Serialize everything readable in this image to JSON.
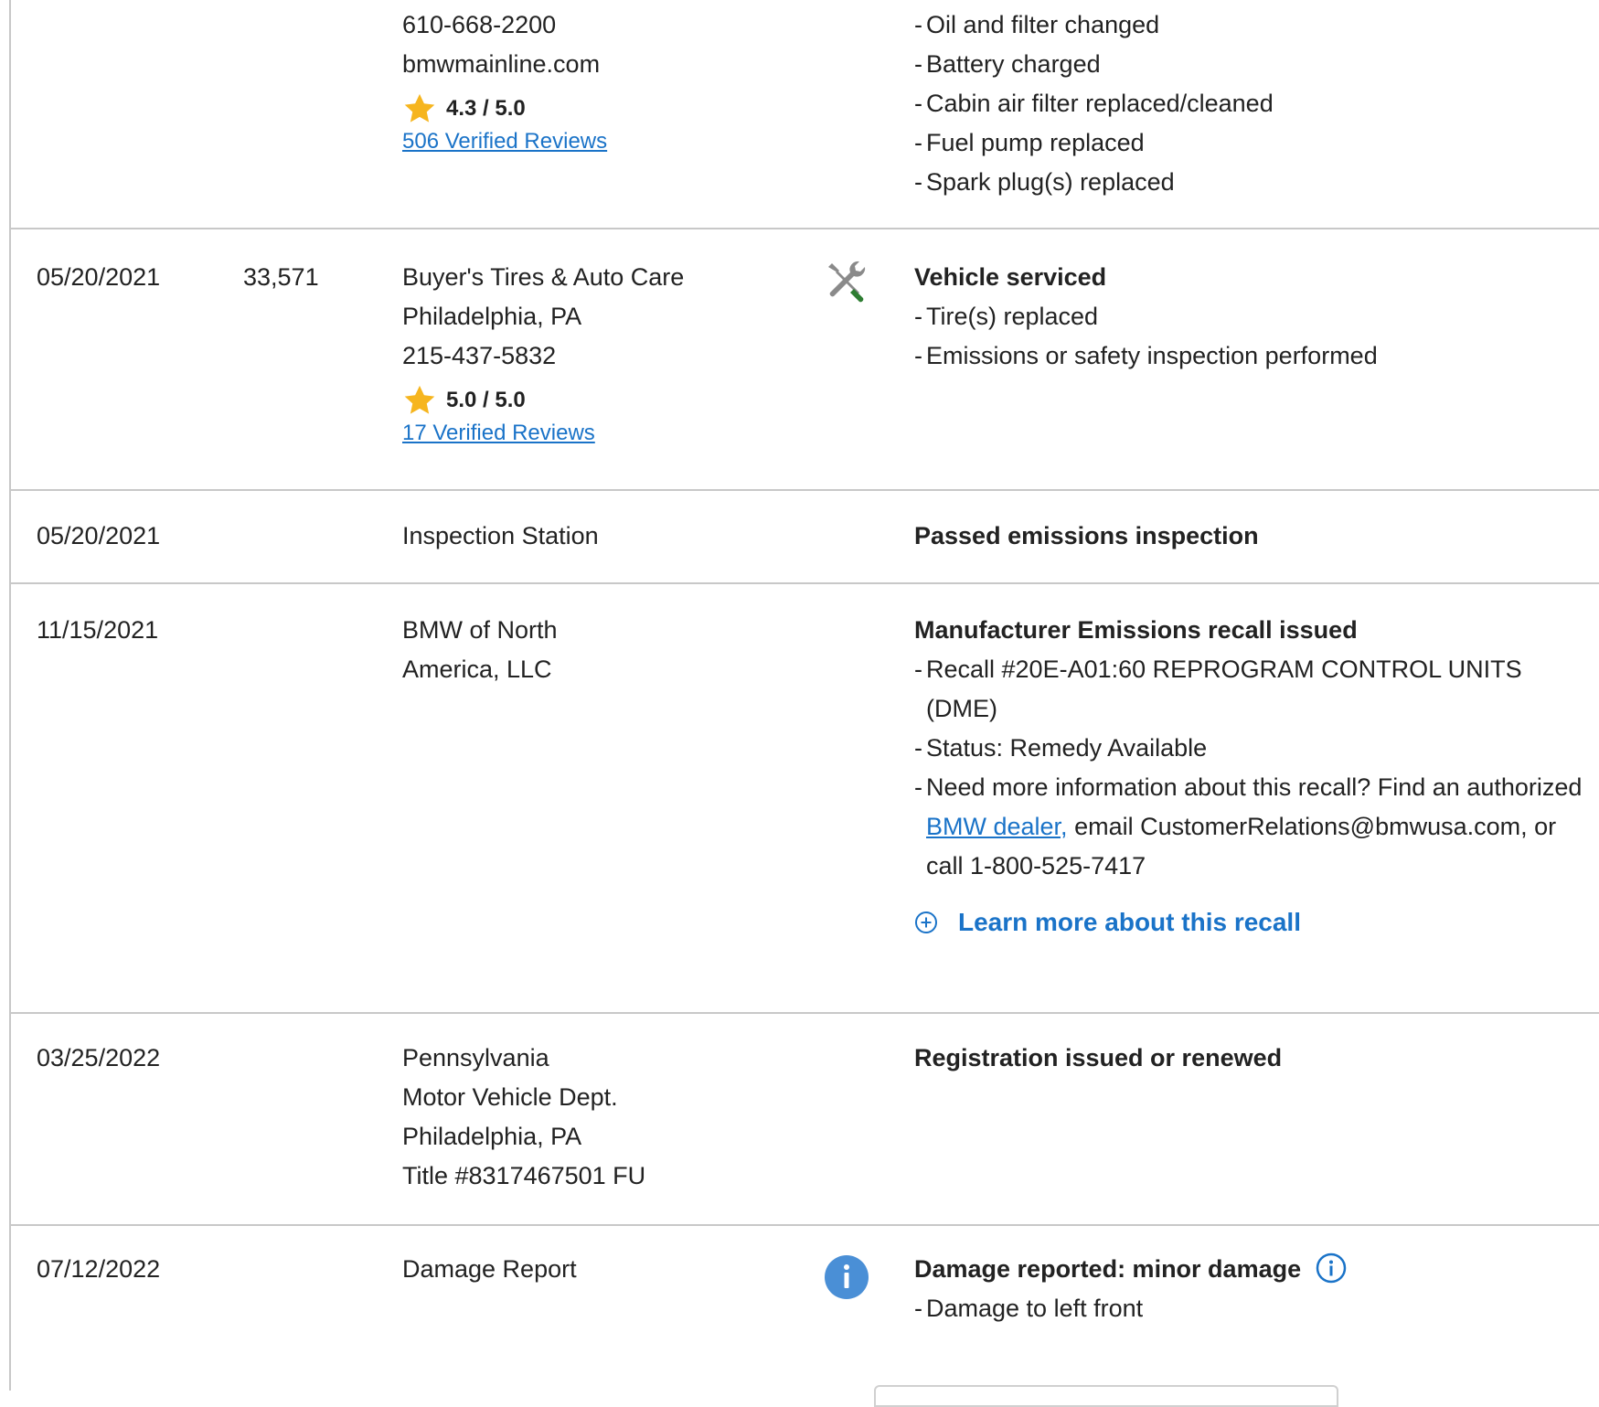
{
  "rows": [
    {
      "date": "",
      "mileage": "",
      "source": {
        "lines": [
          "610-668-2200",
          "bmwmainline.com"
        ],
        "rating": "4.3 / 5.0",
        "reviews": "506 Verified Reviews"
      },
      "details": {
        "title": "",
        "bullets": [
          "Oil and filter changed",
          "Battery charged",
          "Cabin air filter replaced/cleaned",
          "Fuel pump replaced",
          "Spark plug(s) replaced"
        ]
      }
    },
    {
      "date": "05/20/2021",
      "mileage": "33,571",
      "icon": "wrench-screwdriver-icon",
      "source": {
        "lines": [
          "Buyer's Tires & Auto Care",
          "Philadelphia, PA",
          "215-437-5832"
        ],
        "rating": "5.0 / 5.0",
        "reviews": "17 Verified Reviews"
      },
      "details": {
        "title": "Vehicle serviced",
        "bullets": [
          "Tire(s) replaced",
          "Emissions or safety inspection performed"
        ]
      }
    },
    {
      "date": "05/20/2021",
      "mileage": "",
      "source": {
        "lines": [
          "Inspection Station"
        ]
      },
      "details": {
        "title": "Passed emissions inspection",
        "bullets": []
      }
    },
    {
      "date": "11/15/2021",
      "mileage": "",
      "source": {
        "lines": [
          "BMW of North",
          "America, LLC"
        ]
      },
      "details": {
        "title": "Manufacturer Emissions recall issued",
        "bullets": [
          "Recall #20E-A01:60 REPROGRAM CONTROL UNITS (DME)",
          "Status: Remedy Available"
        ],
        "recall_info_prefix": "Need more information about this recall? Find an authorized ",
        "recall_info_link": "BMW dealer,",
        "recall_info_suffix": " email CustomerRelations@bmwusa.com, or call 1-800-525-7417",
        "learn_more": "Learn more about this recall"
      }
    },
    {
      "date": "03/25/2022",
      "mileage": "",
      "source": {
        "lines": [
          "Pennsylvania",
          "Motor Vehicle Dept.",
          "Philadelphia, PA",
          "Title #8317467501 FU"
        ]
      },
      "details": {
        "title": "Registration issued or renewed",
        "bullets": []
      }
    },
    {
      "date": "07/12/2022",
      "mileage": "",
      "icon": "info-icon",
      "source": {
        "lines": [
          "Damage Report"
        ]
      },
      "details": {
        "title": "Damage reported: minor damage",
        "bullets": [
          "Damage to left front"
        ]
      }
    }
  ],
  "colors": {
    "link": "#1a73c8",
    "star": "#f6b51e",
    "info_circle": "#4a8fd6",
    "screwdriver_handle": "#2e7d32",
    "divider": "#c8c8c8"
  }
}
